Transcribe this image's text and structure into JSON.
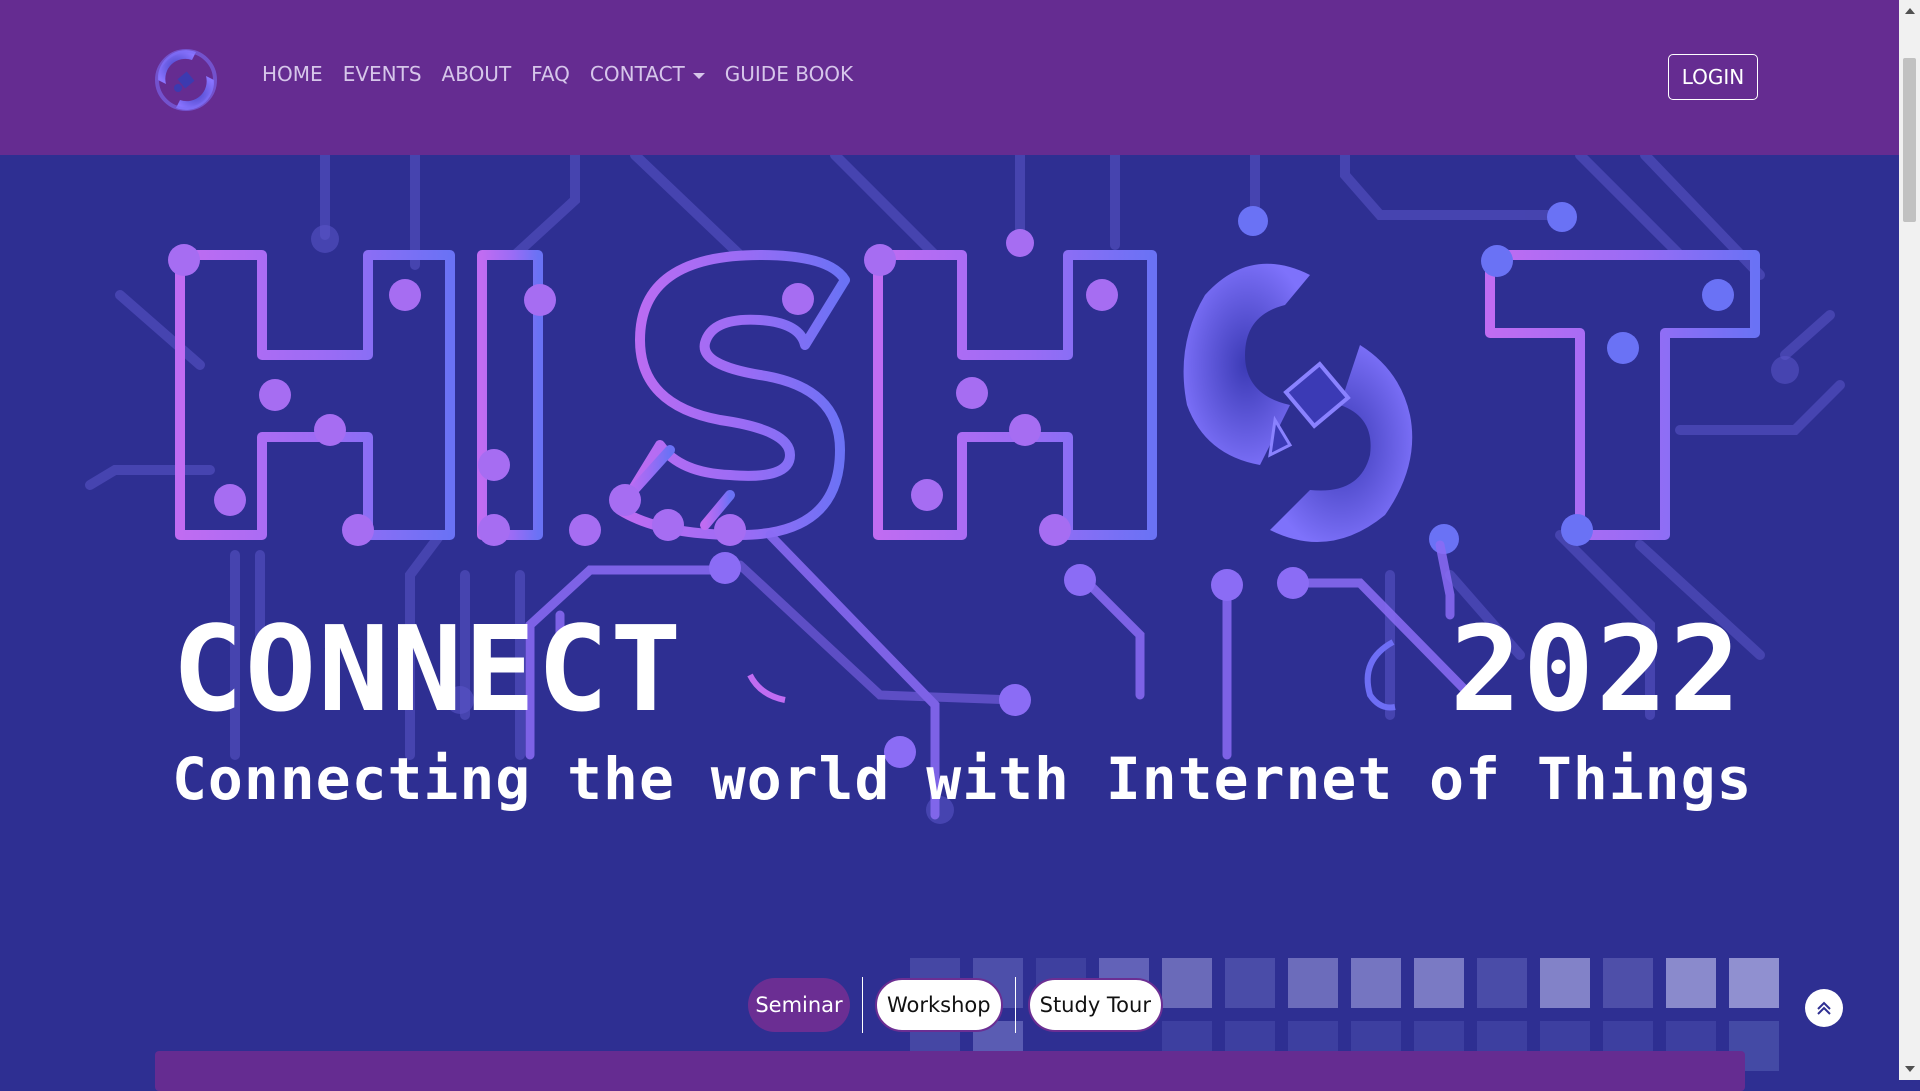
{
  "nav": {
    "items": [
      {
        "label": "HOME"
      },
      {
        "label": "EVENTS"
      },
      {
        "label": "ABOUT"
      },
      {
        "label": "FAQ"
      },
      {
        "label": "CONTACT"
      },
      {
        "label": "GUIDE BOOK"
      }
    ],
    "login_label": "LOGIN"
  },
  "hero": {
    "logo_word": "HISHOT",
    "connect": "CONNECT",
    "year": "2022",
    "tagline": "Connecting the world with Internet of Things"
  },
  "tabs": [
    {
      "label": "Seminar",
      "active": true
    },
    {
      "label": "Workshop",
      "active": false
    },
    {
      "label": "Study Tour",
      "active": false
    }
  ],
  "colors": {
    "navbar": "#652c91",
    "hero_background": "#2e2f92",
    "accent": "#6b2e93",
    "circuit_pink": "#b46df0",
    "circuit_blue": "#6e6ef5"
  },
  "icons": {
    "brand": "satellite-logo-icon",
    "scroll_top": "double-chevron-up-icon",
    "dropdown": "caret-down-icon"
  }
}
